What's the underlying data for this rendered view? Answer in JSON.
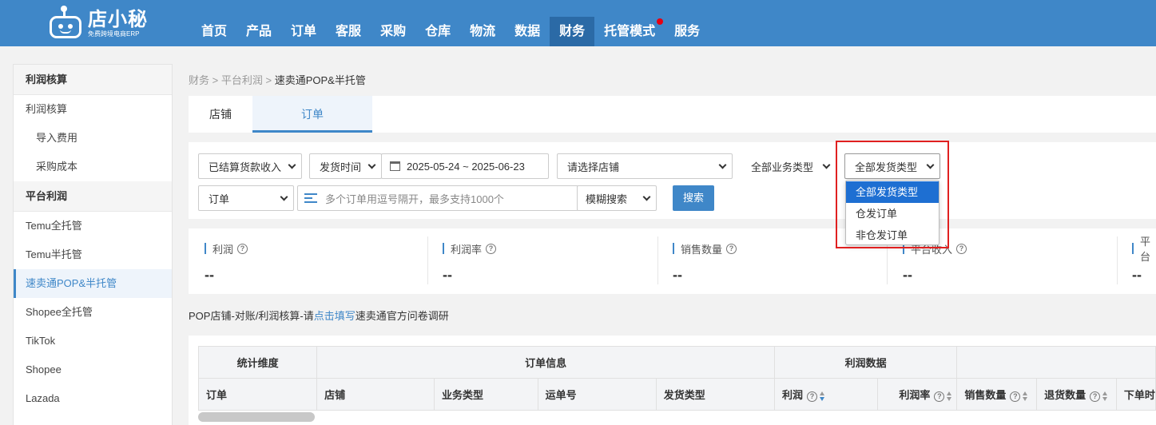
{
  "app": {
    "logo_name": "店小秘",
    "logo_slogan": "免费跨境电商ERP"
  },
  "nav": {
    "items": [
      {
        "label": "首页"
      },
      {
        "label": "产品"
      },
      {
        "label": "订单"
      },
      {
        "label": "客服"
      },
      {
        "label": "采购"
      },
      {
        "label": "仓库"
      },
      {
        "label": "物流"
      },
      {
        "label": "数据"
      },
      {
        "label": "财务"
      },
      {
        "label": "托管模式"
      },
      {
        "label": "服务"
      }
    ],
    "active": "财务"
  },
  "sidebar": {
    "group1": "利润核算",
    "item_profit": "利润核算",
    "item_import": "导入费用",
    "item_purchase_cost": "采购成本",
    "group2": "平台利润",
    "platforms": [
      "Temu全托管",
      "Temu半托管",
      "速卖通POP&半托管",
      "Shopee全托管",
      "TikTok",
      "Shopee",
      "Lazada"
    ],
    "active": "速卖通POP&半托管"
  },
  "breadcrumb": {
    "l1": "财务",
    "l2": "平台利润",
    "l3": "速卖通POP&半托管",
    "sep": ">"
  },
  "tabs": {
    "store": "店铺",
    "order": "订单"
  },
  "filters": {
    "income_type": "已结算货款收入",
    "time_type": "发货时间",
    "date_range": "2025-05-24 ~ 2025-06-23",
    "store_select": "请选择店铺",
    "business_type": "全部业务类型",
    "shipping_type": "全部发货类型",
    "search_field": "订单",
    "search_placeholder": "多个订单用逗号隔开，最多支持1000个",
    "match_mode": "模糊搜索",
    "search_button": "搜索"
  },
  "dropdown": {
    "options": [
      "全部发货类型",
      "仓发订单",
      "非仓发订单"
    ],
    "selected": "全部发货类型"
  },
  "stats": [
    {
      "label": "利润",
      "value": "--"
    },
    {
      "label": "利润率",
      "value": "--"
    },
    {
      "label": "销售数量",
      "value": "--"
    },
    {
      "label": "平台收入",
      "value": "--"
    },
    {
      "label": "平台",
      "value": "--"
    }
  ],
  "notice": {
    "prefix": "POP店铺-对账/利润核算-请",
    "link": "点击填写",
    "suffix": "速卖通官方问卷调研"
  },
  "table": {
    "group_headers": {
      "dimension": "统计维度",
      "order_info": "订单信息",
      "profit_data": "利润数据"
    },
    "columns": [
      "订单",
      "店铺",
      "业务类型",
      "运单号",
      "发货类型",
      "利润",
      "利润率",
      "销售数量",
      "退货数量",
      "下单时"
    ]
  },
  "colors": {
    "brand": "#3f87c8",
    "highlight": "#e02020",
    "selected_option": "#1e6fd2"
  }
}
